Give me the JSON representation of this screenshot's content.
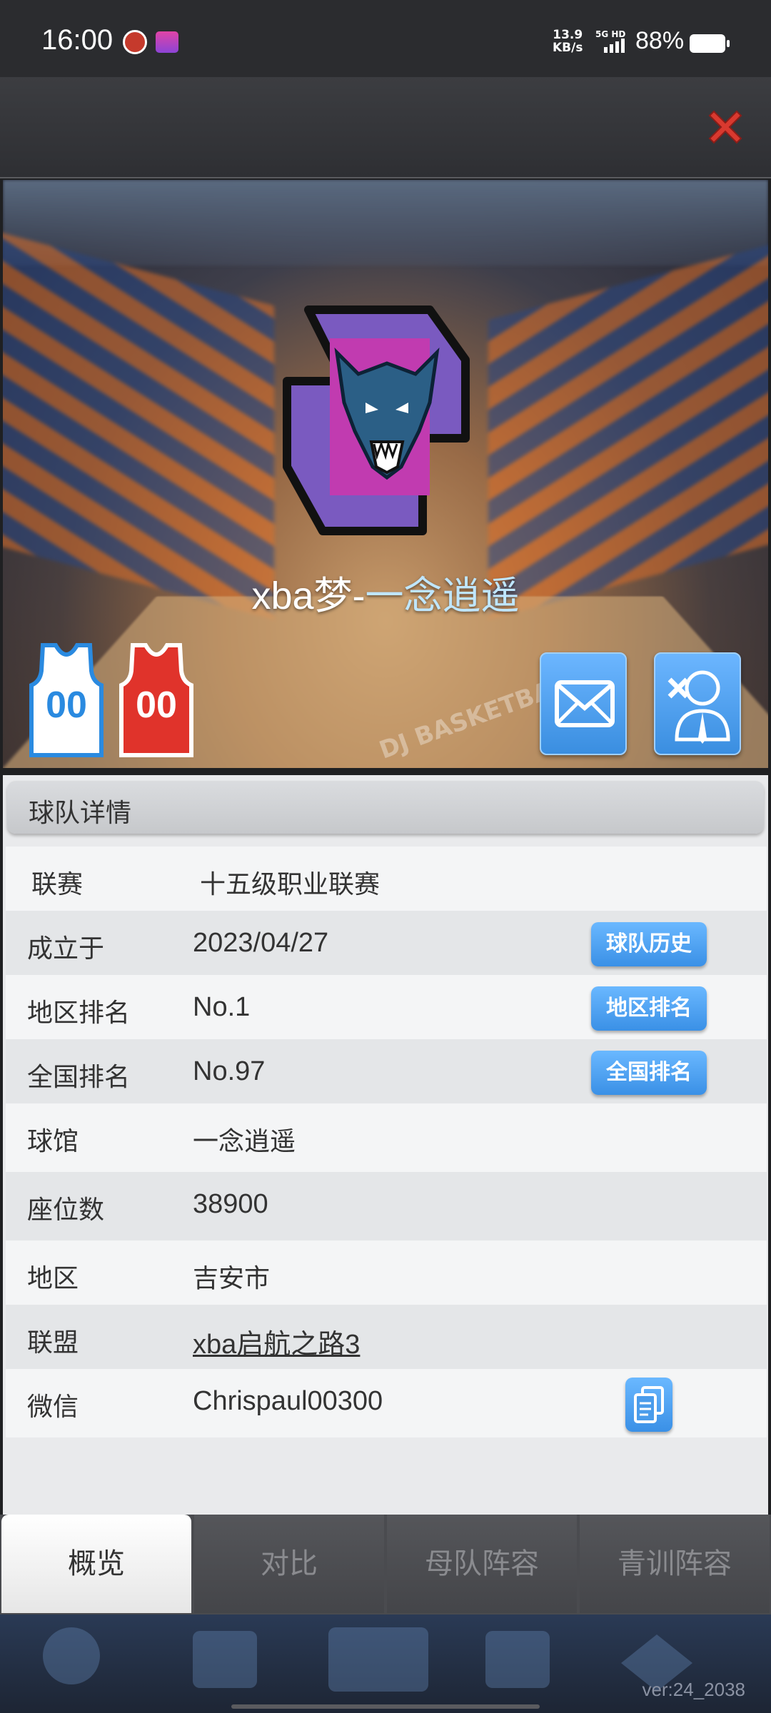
{
  "status": {
    "time": "16:00",
    "net_speed_value": "13.9",
    "net_speed_unit": "KB/s",
    "network": "5G HD",
    "battery": "88%"
  },
  "team": {
    "name_part1": "xba梦-",
    "name_part2": "一念逍遥",
    "jersey_home": "00",
    "jersey_away": "00"
  },
  "details": {
    "title": "球队详情",
    "rows": [
      {
        "label": "联赛",
        "value": "十五级职业联赛"
      },
      {
        "label": "成立于",
        "value": "2023/04/27",
        "button": "球队历史"
      },
      {
        "label": "地区排名",
        "value": "No.1",
        "button": "地区排名"
      },
      {
        "label": "全国排名",
        "value": "No.97",
        "button": "全国排名"
      },
      {
        "label": "球馆",
        "value": "一念逍遥"
      },
      {
        "label": "座位数",
        "value": "38900"
      },
      {
        "label": "地区",
        "value": "吉安市"
      },
      {
        "label": "联盟",
        "value": "xba启航之路3"
      },
      {
        "label": "微信",
        "value": "Chrispaul00300"
      }
    ]
  },
  "tabs": [
    "概览",
    "对比",
    "母队阵容",
    "青训阵容"
  ],
  "hero_banner": "DJ BASKETBALL",
  "version": "ver:24_2038",
  "colors": {
    "accent": "#3a90e6",
    "close": "#d8392f",
    "jersey_home": "#2a8ae0",
    "jersey_away": "#e0332b"
  }
}
